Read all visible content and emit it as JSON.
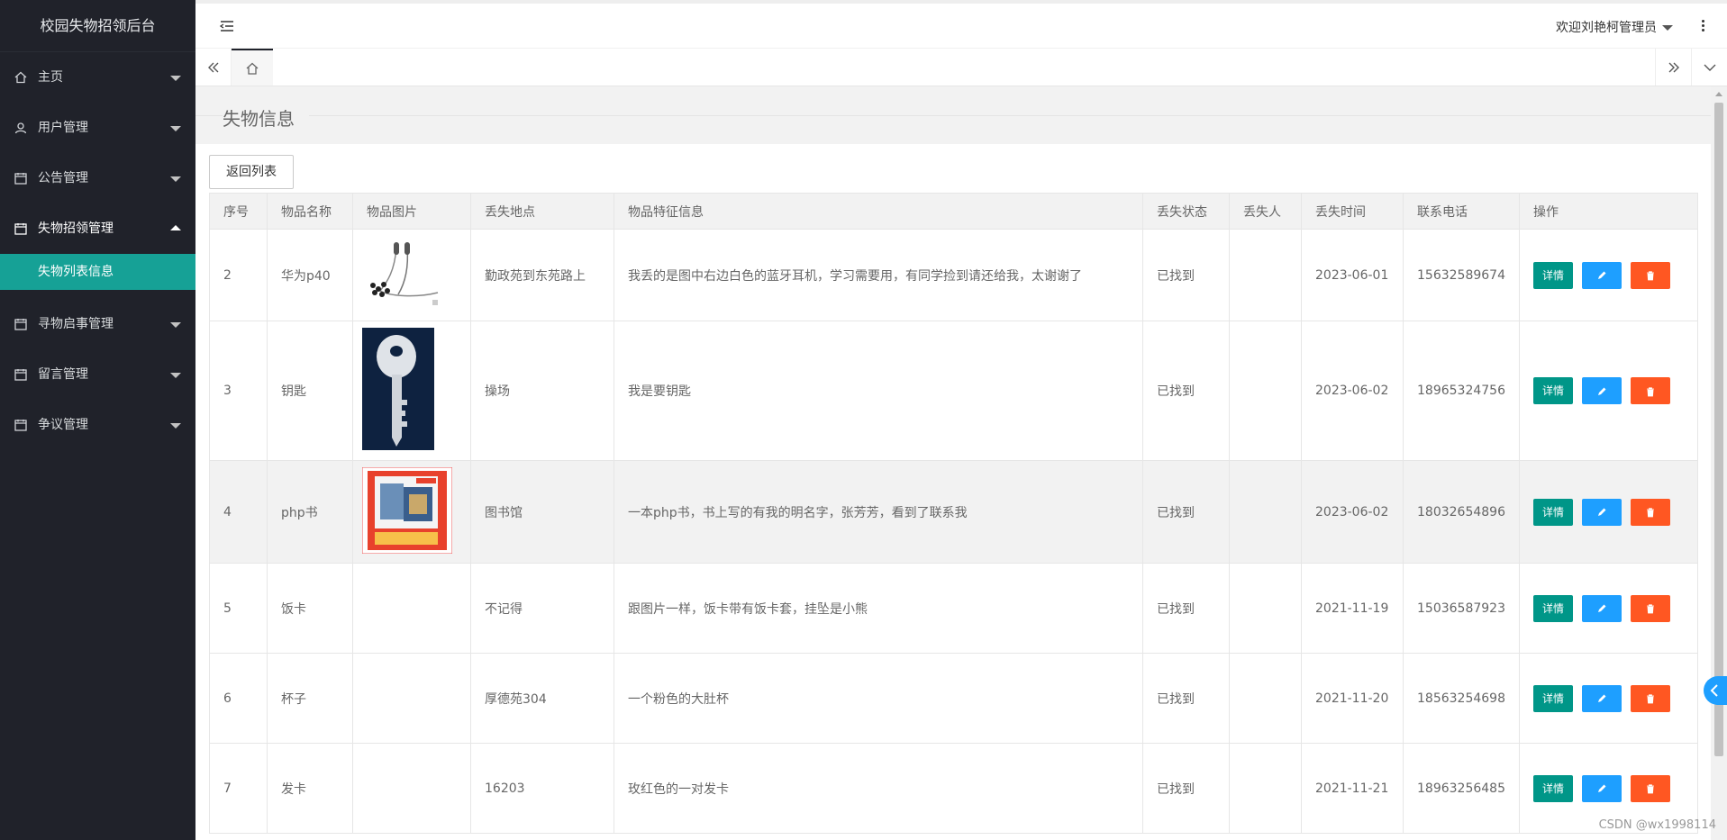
{
  "app_title": "校园失物招领后台",
  "sidebar": {
    "items": [
      {
        "label": "主页",
        "icon": "home-icon"
      },
      {
        "label": "用户管理",
        "icon": "user-icon"
      },
      {
        "label": "公告管理",
        "icon": "calendar-icon"
      },
      {
        "label": "失物招领管理",
        "icon": "calendar-icon"
      },
      {
        "label": "寻物启事管理",
        "icon": "calendar-icon"
      },
      {
        "label": "留言管理",
        "icon": "calendar-icon"
      },
      {
        "label": "争议管理",
        "icon": "calendar-icon"
      }
    ],
    "active_sub": "失物列表信息"
  },
  "header": {
    "welcome": "欢迎刘艳柯管理员"
  },
  "panel": {
    "title": "失物信息",
    "back_button": "返回列表"
  },
  "table": {
    "columns": [
      "序号",
      "物品名称",
      "物品图片",
      "丢失地点",
      "物品特征信息",
      "丢失状态",
      "丢失人",
      "丢失时间",
      "联系电话",
      "操作"
    ],
    "rows": [
      {
        "id": "2",
        "name": "华为p40",
        "image": "earphones",
        "place": "勤政苑到东苑路上",
        "desc": "我丢的是图中右边白色的蓝牙耳机，学习需要用，有同学捡到请还给我，太谢谢了",
        "status": "已找到",
        "person": "",
        "date": "2023-06-01",
        "phone": "15632589674"
      },
      {
        "id": "3",
        "name": "钥匙",
        "image": "key",
        "place": "操场",
        "desc": "我是要钥匙",
        "status": "已找到",
        "person": "",
        "date": "2023-06-02",
        "phone": "18965324756"
      },
      {
        "id": "4",
        "name": "php书",
        "image": "book",
        "place": "图书馆",
        "desc": "一本php书，书上写的有我的明名字，张芳芳，看到了联系我",
        "status": "已找到",
        "person": "",
        "date": "2023-06-02",
        "phone": "18032654896"
      },
      {
        "id": "5",
        "name": "饭卡",
        "image": "",
        "place": "不记得",
        "desc": "跟图片一样，饭卡带有饭卡套，挂坠是小熊",
        "status": "已找到",
        "person": "",
        "date": "2021-11-19",
        "phone": "15036587923"
      },
      {
        "id": "6",
        "name": "杯子",
        "image": "",
        "place": "厚德苑304",
        "desc": "一个粉色的大肚杯",
        "status": "已找到",
        "person": "",
        "date": "2021-11-20",
        "phone": "18563254698"
      },
      {
        "id": "7",
        "name": "发卡",
        "image": "",
        "place": "16203",
        "desc": "玫红色的一对发卡",
        "status": "已找到",
        "person": "",
        "date": "2021-11-21",
        "phone": "18963256485"
      }
    ],
    "op_labels": {
      "detail": "详情"
    }
  },
  "watermark": "CSDN @wx1998114",
  "colors": {
    "sidebar": "#20222a",
    "active": "#16a196",
    "detail": "#009688",
    "edit": "#1e9fff",
    "delete": "#ff5722"
  }
}
